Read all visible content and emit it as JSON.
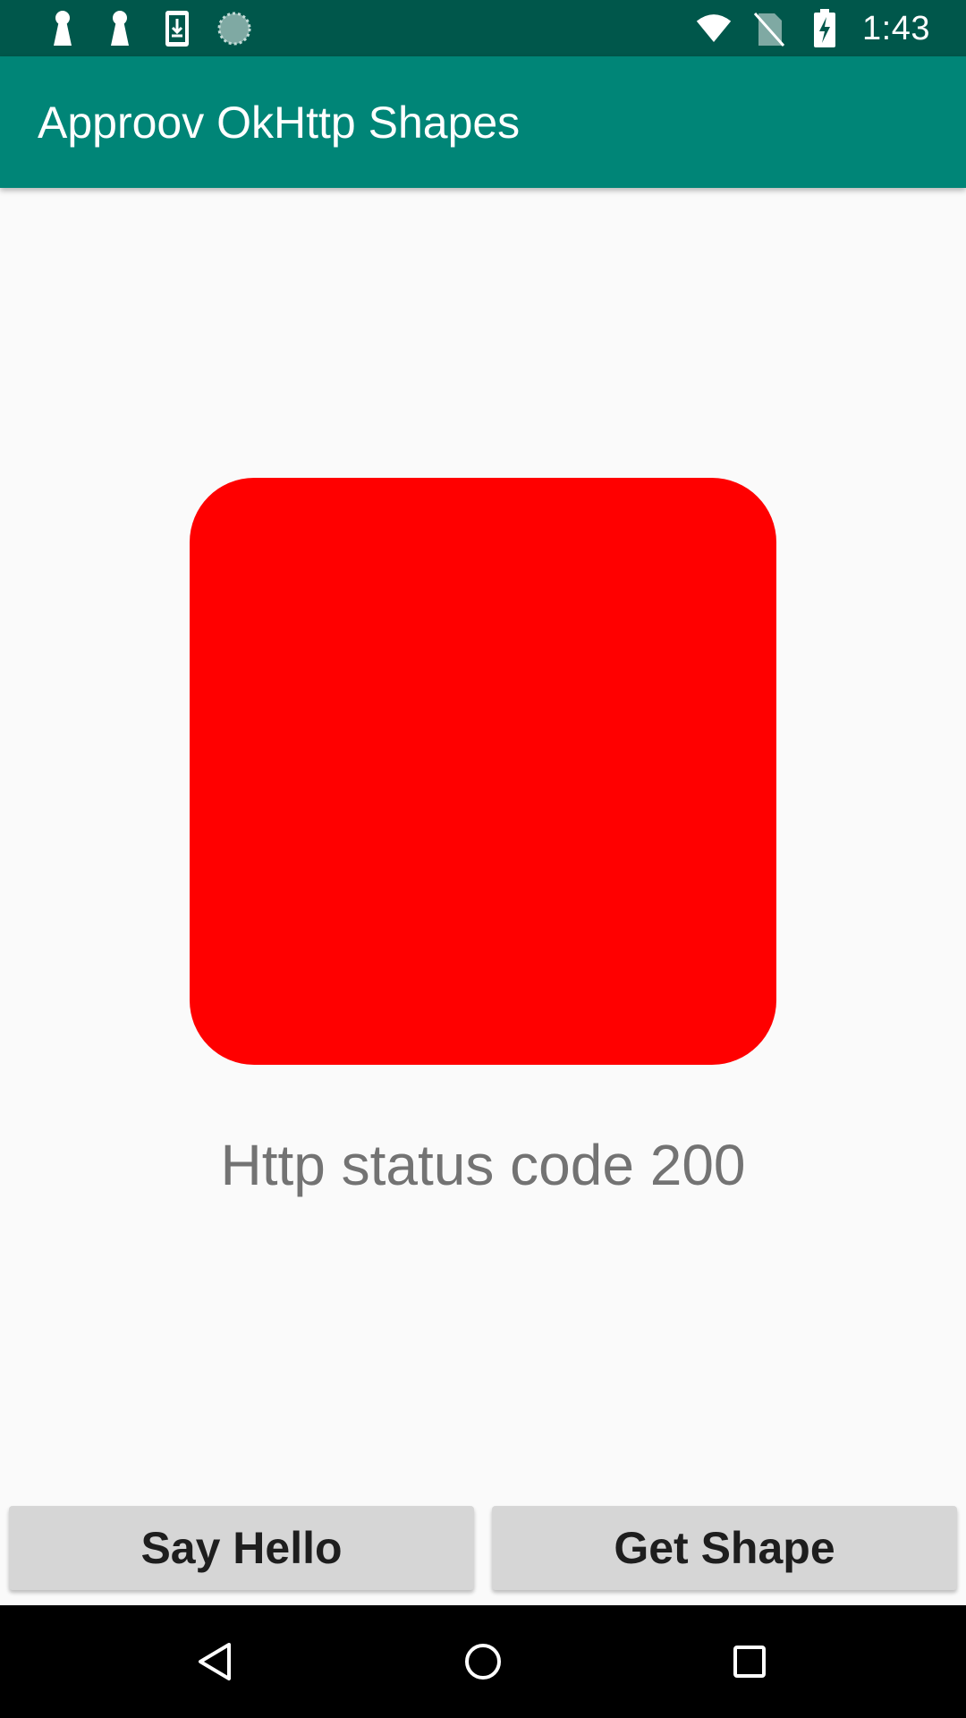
{
  "status_bar": {
    "time": "1:43",
    "left_icons": [
      "keyhole-icon",
      "keyhole-icon",
      "download-icon",
      "loading-icon"
    ],
    "right_icons": [
      "wifi-icon",
      "no-sim-icon",
      "battery-charging-icon"
    ]
  },
  "app_bar": {
    "title": "Approov OkHttp Shapes"
  },
  "main": {
    "shape": {
      "type": "rounded-square",
      "color": "#ff0000"
    },
    "status_text": "Http status code 200"
  },
  "buttons": {
    "say_hello_label": "Say Hello",
    "get_shape_label": "Get Shape"
  },
  "nav_bar": {
    "icons": [
      "back-icon",
      "home-icon",
      "recents-icon"
    ]
  },
  "colors": {
    "status_bar": "#00574b",
    "app_bar": "#008577",
    "background": "#fafafa",
    "button": "#d6d6d6"
  }
}
